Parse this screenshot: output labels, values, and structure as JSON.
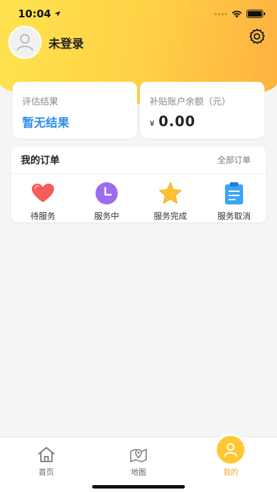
{
  "status_bar": {
    "time": "10:04"
  },
  "profile": {
    "username": "未登录"
  },
  "assessment": {
    "label": "评估结果",
    "value": "暂无结果"
  },
  "subsidy": {
    "label": "补贴账户余额（元）",
    "currency": "¥",
    "amount": "0.00"
  },
  "orders": {
    "title": "我的订单",
    "all_label": "全部订单",
    "items": [
      {
        "label": "待服务",
        "icon": "heart-icon",
        "color": "#f45b5b"
      },
      {
        "label": "服务中",
        "icon": "clock-icon",
        "color": "#9b6cf0"
      },
      {
        "label": "服务完成",
        "icon": "star-icon",
        "color": "#ffc233"
      },
      {
        "label": "服务取消",
        "icon": "clipboard-icon",
        "color": "#3aa6f5"
      }
    ]
  },
  "tabbar": {
    "items": [
      {
        "label": "首页",
        "icon": "home-icon",
        "active": false
      },
      {
        "label": "地图",
        "icon": "map-icon",
        "active": false
      },
      {
        "label": "我的",
        "icon": "user-icon",
        "active": true
      }
    ]
  },
  "colors": {
    "accent": "#ffc833",
    "link_blue": "#2e90e8",
    "active_tab": "#f3a733"
  }
}
